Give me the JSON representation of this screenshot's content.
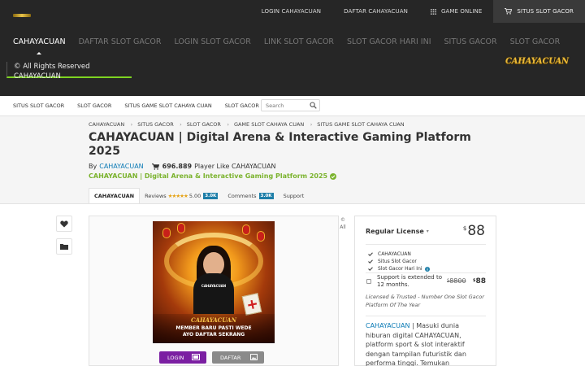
{
  "topbar": {
    "links": [
      {
        "label": "LOGIN CAHAYACUAN"
      },
      {
        "label": "DAFTAR CAHAYACUAN"
      },
      {
        "label": "GAME ONLINE",
        "icon": "grid-icon"
      },
      {
        "label": "SITUS SLOT GACOR",
        "icon": "cart-icon"
      }
    ]
  },
  "header": {
    "nav": [
      "CAHAYACUAN",
      "DAFTAR SLOT GACOR",
      "LOGIN SLOT GACOR",
      "LINK SLOT GACOR",
      "SLOT GACOR HARI INI",
      "SITUS GACOR",
      "SLOT GACOR"
    ],
    "rights": "© All Rights Reserved CAHAYACUAN",
    "logo": "CAHAYACUAN"
  },
  "subnav": {
    "links": [
      "SITUS SLOT GACOR",
      "SLOT GACOR",
      "SITUS GAME SLOT CAHAYA CUAN",
      "SLOT GACOR ONLINE"
    ],
    "search_placeholder": "Search"
  },
  "breadcrumb": [
    "CAHAYACUAN",
    "SITUS GACOR",
    "SLOT GACOR",
    "GAME SLOT CAHAYA CUAN",
    "SITUS GAME SLOT CAHAYA CUAN"
  ],
  "title": "CAHAYACUAN | Digital Arena & Interactive Gaming Platform 2025",
  "byline": {
    "by": "By",
    "author": "CAHAYACUAN",
    "count": "696.889",
    "count_label": "Player Like CAHAYACUAN"
  },
  "green_title": "CAHAYACUAN | Digital Arena & Interactive Gaming Platform 2025",
  "tabs": {
    "main": "CAHAYACUAN",
    "reviews_label": "Reviews",
    "stars": "★★★★★",
    "rating": "5.00",
    "reviews_count": "3.0K",
    "comments_label": "Comments",
    "comments_count": "3.0K",
    "support": "Support"
  },
  "preview": {
    "all_note": "© All",
    "promo_brand": "CAHAYACUAN",
    "promo_title": "CAHAYACUAN",
    "promo_line1": "MEMBER BARU PASTI WEDE",
    "promo_line2": "AYO DAFTAR SEKRANG",
    "login_button": "LOGIN",
    "daftar_button": "DAFTAR"
  },
  "license": {
    "name": "Regular License",
    "currency": "$",
    "price": "88",
    "features": [
      "CAHAYACUAN",
      "Situs Slot Gacor",
      "Slot Gacor Hari Ini"
    ],
    "support_text": "Support is extended to 12 months.",
    "old_price": "8800",
    "new_price": "88",
    "tagline": "Licensed & Trusted - Number One Slot Gacor Platform Of The Year",
    "desc_brand": "CAHAYACUAN",
    "desc_rest": " | Masuki dunia hiburan digital CAHAYACUAN, platform sport & slot interaktif dengan tampilan futuristik dan performa tinggi. Temukan pengalaman seru, bonus"
  },
  "colors": {
    "header_bg": "#262626",
    "accent_green": "#7ed321",
    "brand_title_green": "#7bb32e",
    "link_blue": "#0b7ab5",
    "login_purple": "#7b1fa2",
    "daftar_grey": "#8a8a8a",
    "logo_gold": "#e9b93a"
  }
}
